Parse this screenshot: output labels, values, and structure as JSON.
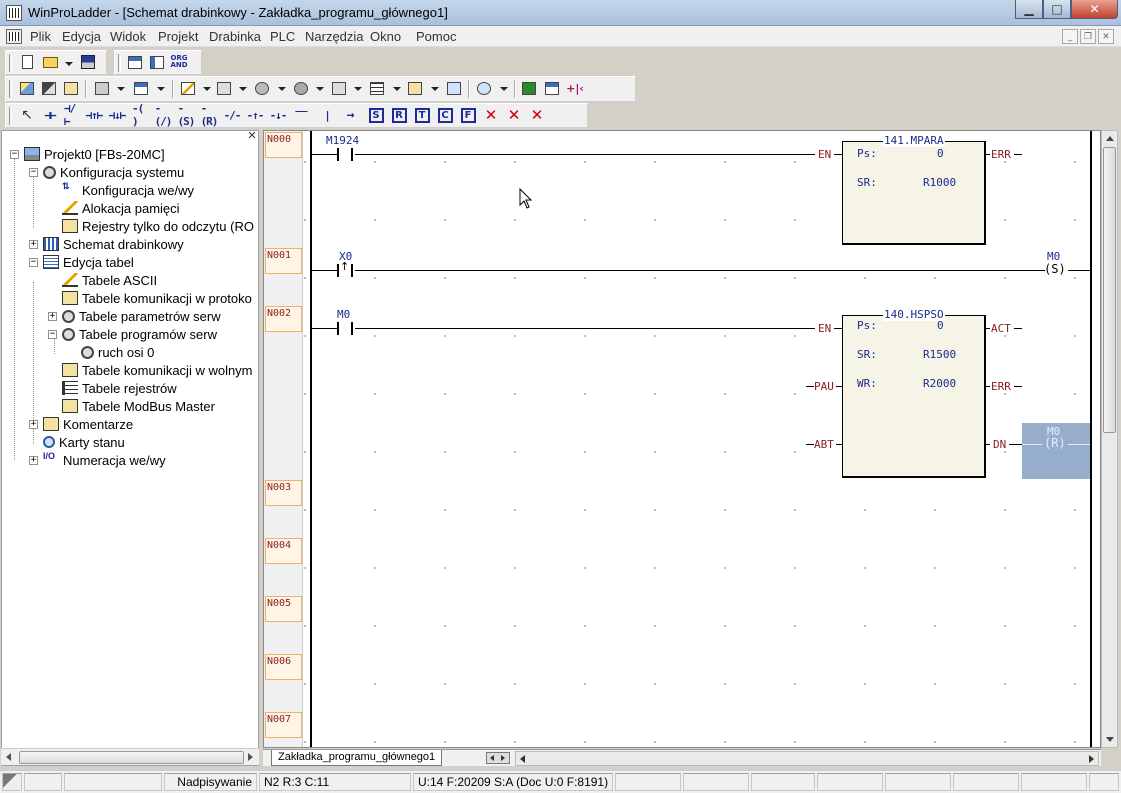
{
  "window": {
    "title": "WinProLadder - [Schemat drabinkowy - Zakładka_programu_głównego1]",
    "minimize_glyph": "▁",
    "maximize_glyph": "□",
    "close_glyph": "✕"
  },
  "menu": {
    "items": [
      "Plik",
      "Edycja",
      "Widok",
      "Projekt",
      "Drabinka",
      "PLC",
      "Narzędzia",
      "Okno",
      "Pomoc"
    ],
    "mdi_min": "_",
    "mdi_restore": "❐",
    "mdi_close": "✕"
  },
  "toolbar1": {
    "org_label": "ORG",
    "and_label": "AND"
  },
  "toolbar3": {
    "symbols": [
      "⊣⊢",
      "⊣/⊢",
      "⊣↑⊢",
      "⊣↓⊢",
      "-( )",
      "-(/)",
      "-(S)",
      "-(R)",
      "-/-",
      "-↑-",
      "-↓-",
      "‾‾",
      "|",
      "→"
    ],
    "box_letters": [
      "S",
      "R",
      "T",
      "C",
      "F"
    ],
    "delete_icons": [
      "✕",
      "✕",
      "✕"
    ]
  },
  "tree": {
    "close_glyph": "✕",
    "nodes": [
      {
        "label": "Projekt0 [FBs-20MC]",
        "expander": "−"
      },
      {
        "label": "Konfiguracja systemu",
        "expander": "−"
      },
      {
        "label": "Konfiguracja we/wy"
      },
      {
        "label": "Alokacja pamięci"
      },
      {
        "label": "Rejestry tylko do odczytu (RO"
      },
      {
        "label": "Schemat drabinkowy",
        "expander": "+"
      },
      {
        "label": "Edycja tabel",
        "expander": "−"
      },
      {
        "label": "Tabele ASCII"
      },
      {
        "label": "Tabele komunikacji w protoko"
      },
      {
        "label": "Tabele parametrów serw",
        "expander": "+"
      },
      {
        "label": "Tabele programów serw",
        "expander": "−"
      },
      {
        "label": "ruch osi 0"
      },
      {
        "label": "Tabele komunikacji w wolnym"
      },
      {
        "label": "Tabele rejestrów"
      },
      {
        "label": "Tabele ModBus Master"
      },
      {
        "label": "Komentarze",
        "expander": "+"
      },
      {
        "label": "Karty stanu"
      },
      {
        "label": "Numeracja we/wy",
        "expander": "+"
      }
    ]
  },
  "ladder": {
    "rungs": [
      "N000",
      "N001",
      "N002",
      "N003",
      "N004",
      "N005",
      "N006",
      "N007"
    ],
    "contacts": {
      "c1": "M1924",
      "c2": "X0",
      "c3": "M0"
    },
    "fb1": {
      "title": "141.MPARA",
      "ps_key": "Ps:",
      "ps_val": "0",
      "sr_key": "SR:",
      "sr_val": "R1000",
      "pin_en": "EN",
      "pin_err": "ERR"
    },
    "fb2": {
      "title": "140.HSPSO",
      "ps_key": "Ps:",
      "ps_val": "0",
      "sr_key": "SR:",
      "sr_val": "R1500",
      "wr_key": "WR:",
      "wr_val": "R2000",
      "pin_en": "EN",
      "pin_pau": "PAU",
      "pin_abt": "ABT",
      "pin_act": "ACT",
      "pin_err": "ERR",
      "pin_dn": "DN"
    },
    "coil1": {
      "name": "M0",
      "symbol": "(S)"
    },
    "coil2": {
      "name": "M0",
      "symbol": "(R)"
    }
  },
  "tabs": {
    "main_tab": "Zakładka_programu_głównego1"
  },
  "status": {
    "mode": "Nadpisywanie",
    "position": "N2 R:3 C:11",
    "usage": "U:14 F:20209 S:A (Doc U:0 F:8191)"
  }
}
